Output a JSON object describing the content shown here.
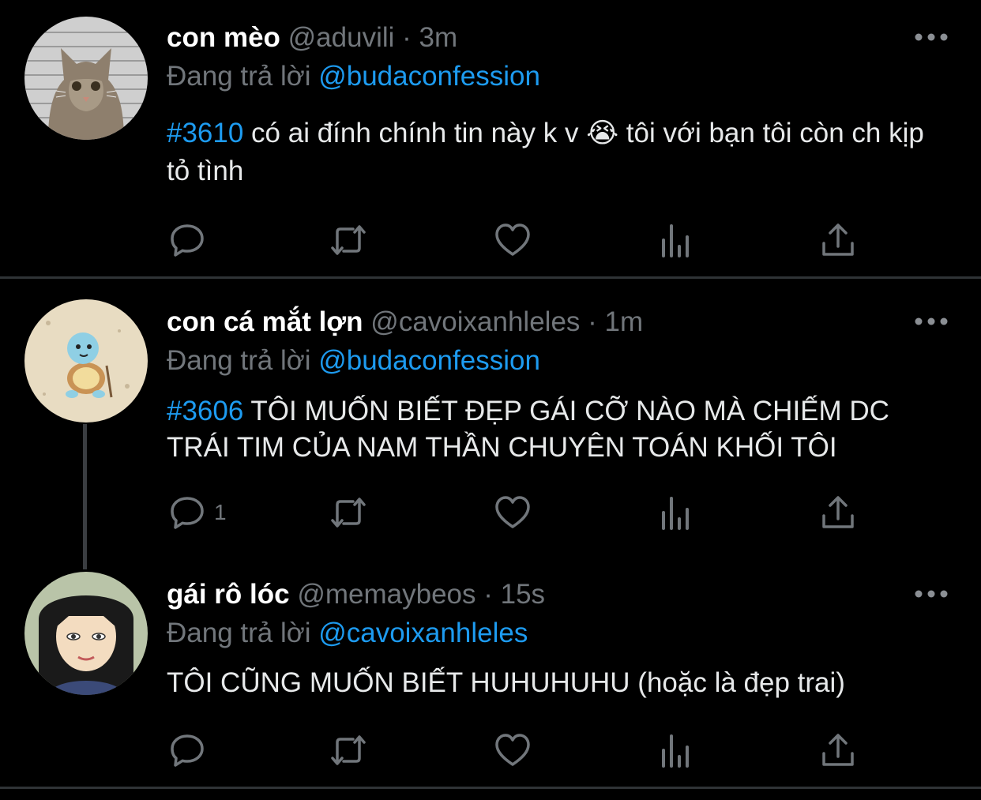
{
  "theme": {
    "background": "#000000",
    "text": "#e7e9ea",
    "muted": "#71767b",
    "accent": "#1d9bf0",
    "divider": "#2f3336"
  },
  "tweets": [
    {
      "name": "con mèo",
      "handle": "@aduvili",
      "separator": "·",
      "time": "3m",
      "reply_prefix": "Đang trả lời",
      "reply_to": "@budaconfession",
      "hashtag": "#3610",
      "text": " có ai đính chính tin này k v 😭 tôi với bạn tôi còn ch kịp tỏ tình",
      "reply_count": "",
      "avatar": "cat-mugshot-avatar"
    },
    {
      "name": "con cá mắt lợn",
      "handle": "@cavoixanhleles",
      "separator": "·",
      "time": "1m",
      "reply_prefix": "Đang trả lời",
      "reply_to": "@budaconfession",
      "hashtag": "#3606",
      "text": " TÔI MUỐN BIẾT ĐẸP GÁI CỠ NÀO MÀ CHIẾM DC TRÁI TIM CỦA NAM THẦN CHUYÊN TOÁN KHỐI TÔI",
      "reply_count": "1",
      "avatar": "squirtle-avatar"
    },
    {
      "name": "gái rô lóc",
      "handle": "@memaybeos",
      "separator": "·",
      "time": "15s",
      "reply_prefix": "Đang trả lời",
      "reply_to": "@cavoixanhleles",
      "hashtag": "",
      "text": "TÔI CŨNG MUỐN BIẾT HUHUHUHU (hoặc là đẹp trai)",
      "reply_count": "",
      "avatar": "cartoon-girl-avatar"
    }
  ],
  "icons": {
    "reply": "reply-icon",
    "retweet": "retweet-icon",
    "like": "heart-icon",
    "views": "views-icon",
    "share": "share-icon",
    "more": "more-icon"
  }
}
